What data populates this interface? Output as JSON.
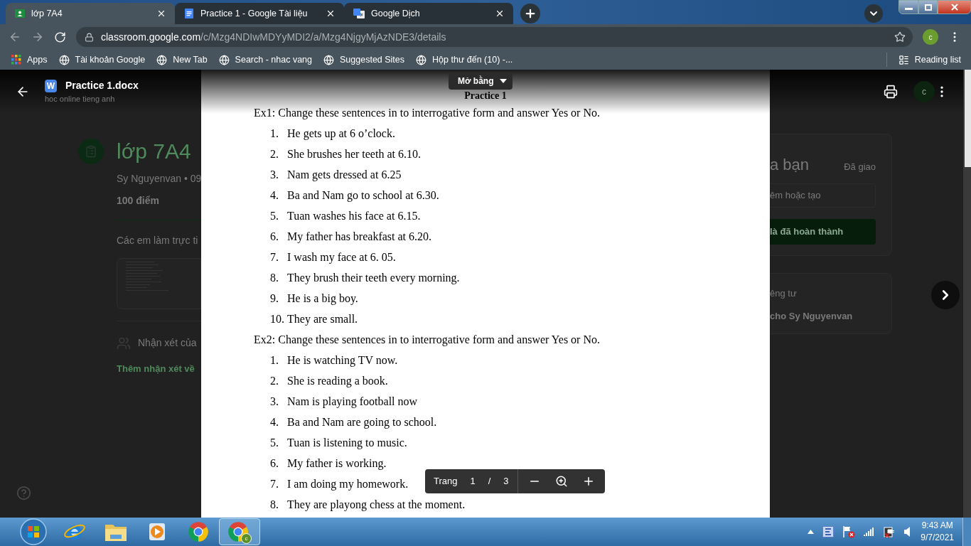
{
  "browser": {
    "tabs": [
      {
        "kind": "classroom",
        "title": "lớp 7A4",
        "selected": true
      },
      {
        "kind": "docs",
        "title": "Practice 1 - Google Tài liệu",
        "selected": false
      },
      {
        "kind": "translate",
        "title": "Google Dịch",
        "selected": false
      }
    ],
    "address": {
      "domain": "classroom.google.com",
      "path": "/c/Mzg4NDIwMDYyMDI2/a/Mzg4NjgyMjAzNDE3/details"
    },
    "profile_initial": "c",
    "bookmarks": [
      {
        "kind": "apps",
        "label": "Apps"
      },
      {
        "kind": "site",
        "label": "Tài khoản Google"
      },
      {
        "kind": "site",
        "label": "New Tab"
      },
      {
        "kind": "site",
        "label": "Search - nhac vang"
      },
      {
        "kind": "site",
        "label": "Suggested Sites"
      },
      {
        "kind": "site",
        "label": "Hộp thư đến (10) -..."
      }
    ],
    "reading_list": "Reading list"
  },
  "viewer": {
    "file_type_letter": "W",
    "file_name": "Practice 1.docx",
    "open_with": "Mở bằng",
    "page_label": "Trang",
    "page_current": "1",
    "page_separator": "/",
    "page_total": "3"
  },
  "background": {
    "class_subtitle": "hoc online tieng anh",
    "avatar_initial": "c",
    "title": "lớp 7A4",
    "meta": "Sy Nguyenvan • 09",
    "points": "100 điểm",
    "description": "Các em làm trực ti",
    "comments_heading": "Nhận xét của",
    "add_comment": "Thêm nhận xét về",
    "work_title": "a bạn",
    "work_status": "Đã giao",
    "work_add": "êm hoặc tạo",
    "work_done": "là đã hoàn thành",
    "private_heading": "êng tư",
    "private_add": "cho Sy Nguyenvan"
  },
  "document": {
    "title": "Practice 1",
    "sections": [
      {
        "heading": "Ex1: Change these sentences in to interrogative form and answer Yes or No.",
        "items": [
          {
            "number": "1.",
            "text": "He gets up at 6 o’clock."
          },
          {
            "number": "2.",
            "text": "She brushes her teeth at 6.10."
          },
          {
            "number": "3.",
            "text": "Nam gets dressed at 6.25"
          },
          {
            "number": "4.",
            "text": "Ba and Nam go to school at 6.30."
          },
          {
            "number": "5.",
            "text": "Tuan washes his face at 6.15."
          },
          {
            "number": "6.",
            "text": "My father has breakfast at 6.20."
          },
          {
            "number": "7.",
            "text": "I wash my face at 6. 05."
          },
          {
            "number": "8.",
            "text": "They brush their teeth every morning."
          },
          {
            "number": "9.",
            "text": "He is a big boy."
          },
          {
            "number": "10.",
            "text": "They are small."
          }
        ]
      },
      {
        "heading": "Ex2: Change these sentences in to interrogative form and answer Yes or No.",
        "items": [
          {
            "number": "1.",
            "text": "He is watching TV now."
          },
          {
            "number": "2.",
            "text": "She is reading a book."
          },
          {
            "number": "3.",
            "text": "Nam is playing football now"
          },
          {
            "number": "4.",
            "text": "Ba and Nam are going to school."
          },
          {
            "number": "5.",
            "text": "Tuan is listening to music."
          },
          {
            "number": "6.",
            "text": "My father is working."
          },
          {
            "number": "7.",
            "text": "I am doing my homework."
          },
          {
            "number": "8.",
            "text": "They are playong chess at the moment."
          }
        ]
      }
    ]
  },
  "taskbar": {
    "apps": [
      {
        "kind": "start",
        "active": false
      },
      {
        "kind": "ie",
        "active": false
      },
      {
        "kind": "explorer",
        "active": false
      },
      {
        "kind": "media",
        "active": false
      },
      {
        "kind": "chrome",
        "active": false
      },
      {
        "kind": "chrome-profile",
        "active": true
      }
    ],
    "badge_initial": "c",
    "tray": [
      {
        "kind": "show-hidden"
      },
      {
        "kind": "app"
      },
      {
        "kind": "flag"
      },
      {
        "kind": "signal"
      },
      {
        "kind": "power"
      },
      {
        "kind": "volume"
      }
    ],
    "time": "9:43 AM",
    "date": "9/7/2021"
  }
}
